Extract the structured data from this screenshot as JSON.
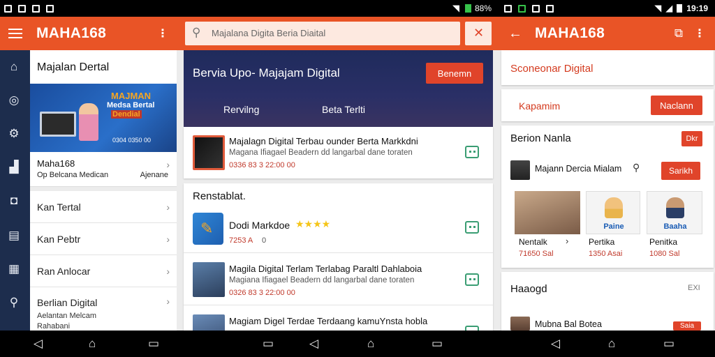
{
  "status_left": {
    "battery": "88%"
  },
  "status_right": {
    "time": "19:19"
  },
  "left_panel": {
    "app_title": "MAHA168",
    "rail_icons": [
      "home-icon",
      "search-circle-icon",
      "settings-icon",
      "person-icon",
      "bookmark-icon",
      "document-icon",
      "grid-icon",
      "search-icon"
    ],
    "heading": "Majalan Dertal",
    "banner": {
      "line1": "MAJMAN",
      "line2": "Medsa Bertal",
      "line3": "Dendial",
      "caption": "0304 0350 00"
    },
    "promo": {
      "title": "Maha168",
      "subtitle": "Op Belcana Medican",
      "extra": "Ajenane"
    },
    "items": [
      {
        "label": "Kan Tertal"
      },
      {
        "label": "Kan Pebtr"
      },
      {
        "label": "Ran Anlocar"
      },
      {
        "label": "Berlian Digital",
        "sub1": "Aelantan Melcam",
        "sub2": "Rahabani"
      }
    ]
  },
  "search": {
    "value": "Majalana Digita Beria Diaital"
  },
  "center": {
    "hero": {
      "title": "Bervia Upo- Majajam Digital",
      "button": "Benemn",
      "tab1": "Rervilng",
      "tab2": "Beta Terlti"
    },
    "feed1": {
      "title": "Majalagn Digital Terbau ounder Berta Markkdni",
      "subtitle": "Magana Ifiagael Beadern dd langarbal dane toraten",
      "meta": "0336 83 3 22:00 00"
    },
    "section_title": "Renstablat.",
    "app_item": {
      "title": "Dodi Markdoe",
      "stars": "★★★★",
      "meta": "7253 A",
      "extra": "0"
    },
    "feed2": {
      "title": "Magila Digital Terlam Terlabag Paraltl Dahlaboia",
      "subtitle": "Magiana Ifiagael Beadern dd langarbal dane toraten",
      "meta": "0326 83 3 22:00 00"
    },
    "feed3": {
      "title": "Magiam Digel Terdae Terdaang kamuYnsta hobla"
    }
  },
  "right_panel": {
    "app_title": "MAHA168",
    "section_title": "Sconeonar Digital",
    "card_label": "Kapamim",
    "card_button": "Naclann",
    "section2_title": "Berion Nanla",
    "section2_badge": "Dkr",
    "person_row": {
      "name": "Majann Dercia Mialam",
      "button": "Sarikh"
    },
    "tiles": [
      {
        "label": "Nentalk",
        "meta": "71650 Sal"
      },
      {
        "label": "Pertika",
        "meta": "1350 Asai",
        "caption": "Paine"
      },
      {
        "label": "Penitka",
        "meta": "1080 Sal",
        "caption": "Baaha"
      }
    ],
    "section3_title": "Haaogd",
    "section3_badge": "EXI",
    "bottom_row": {
      "name": "Mubna Bal Botea",
      "button": "Saia"
    }
  },
  "colors": {
    "orange": "#e95426",
    "navy": "#1d2d4d",
    "red_button": "#e0442a",
    "green_icon": "#3a9d73"
  }
}
